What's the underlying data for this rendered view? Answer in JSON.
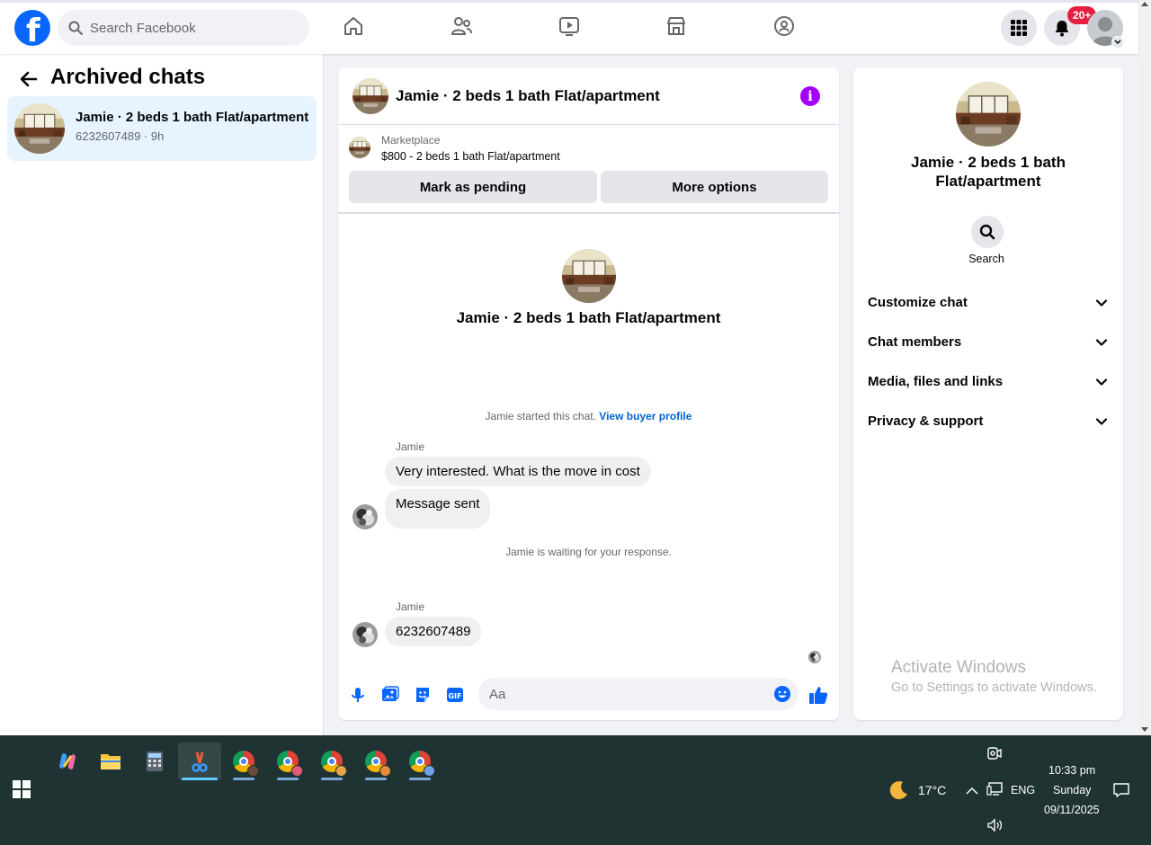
{
  "topnav": {
    "logo": "f",
    "search_placeholder": "Search Facebook",
    "notifications_badge": "20+"
  },
  "left_panel": {
    "title": "Archived chats",
    "chats": [
      {
        "title": "Jamie · 2 beds 1 bath Flat/apartment",
        "subtitle": "6232607489 · 9h"
      }
    ]
  },
  "conversation": {
    "title": "Jamie · 2 beds 1 bath Flat/apartment",
    "marketplace_label": "Marketplace",
    "listing": "$800 - 2 beds 1 bath Flat/apartment",
    "mark_pending_label": "Mark as pending",
    "more_options_label": "More options",
    "intro_title": "Jamie · 2 beds 1 bath Flat/apartment",
    "started_text": "Jamie started this chat.",
    "buyer_profile_link": "View buyer profile",
    "messages": [
      {
        "sender": "Jamie",
        "text": "Very interested. What is the move in cost"
      },
      {
        "sender": "",
        "text": "Message sent"
      },
      {
        "sender": "Jamie",
        "text": "6232607489"
      }
    ],
    "waiting_text": "Jamie is waiting for your response.",
    "composer_placeholder": "Aa"
  },
  "info_panel": {
    "title": "Jamie · 2 beds 1 bath Flat/apartment",
    "search_label": "Search",
    "sections": [
      "Customize chat",
      "Chat members",
      "Media, files and links",
      "Privacy & support"
    ]
  },
  "watermark": {
    "line1": "Activate Windows",
    "line2": "Go to Settings to activate Windows."
  },
  "taskbar": {
    "temperature": "17°C",
    "language": "ENG",
    "time": "10:33 pm",
    "day": "Sunday",
    "date": "09/11/2025"
  },
  "colors": {
    "facebook_blue": "#0866ff",
    "messenger_purple": "#a400ff",
    "badge_red": "#e41e3f",
    "selected_chat_bg": "#e7f3ff",
    "taskbar_bg": "#1f3333"
  }
}
